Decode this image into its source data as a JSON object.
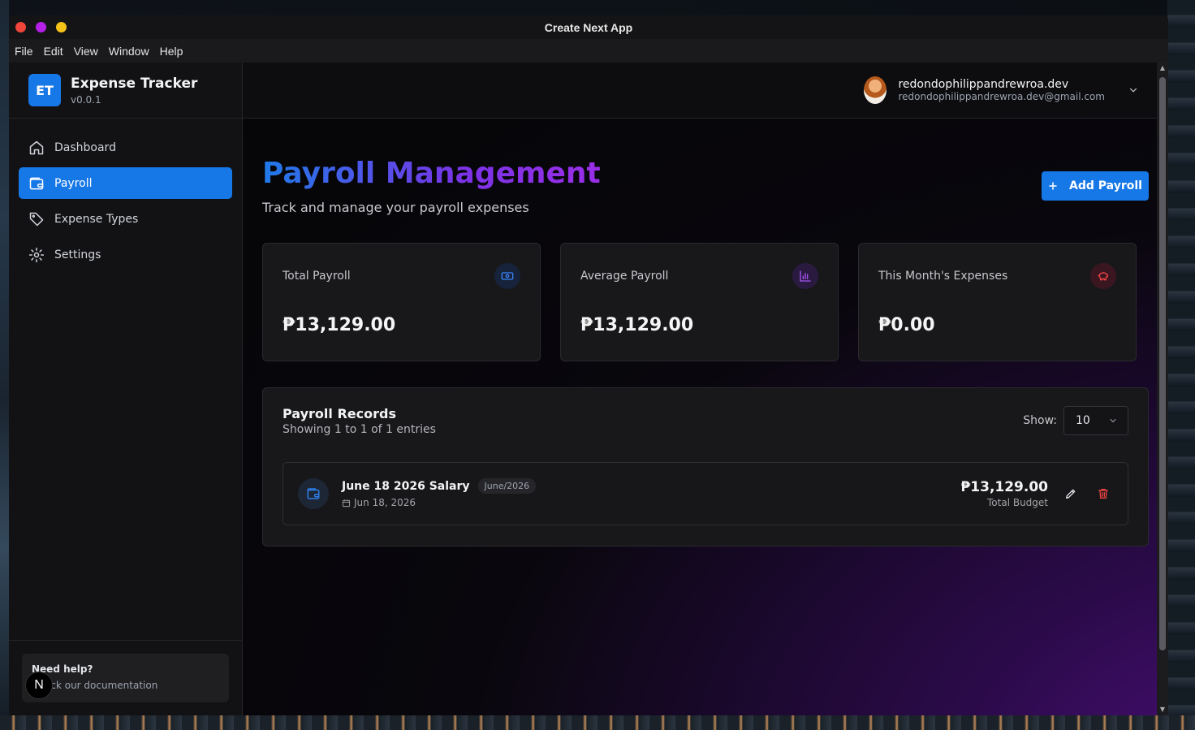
{
  "window": {
    "title": "Create Next App"
  },
  "menu": [
    "File",
    "Edit",
    "View",
    "Window",
    "Help"
  ],
  "sidebar": {
    "logo": "ET",
    "app_name": "Expense Tracker",
    "version": "v0.0.1",
    "items": [
      {
        "label": "Dashboard",
        "icon": "home-icon",
        "active": false
      },
      {
        "label": "Payroll",
        "icon": "wallet-icon",
        "active": true
      },
      {
        "label": "Expense Types",
        "icon": "tag-icon",
        "active": false
      },
      {
        "label": "Settings",
        "icon": "gear-icon",
        "active": false
      }
    ],
    "help": {
      "title": "Need help?",
      "subtitle": "Check our documentation",
      "badge": "N"
    }
  },
  "header": {
    "user_name": "redondophilippandrewroa.dev",
    "user_email": "redondophilippandrewroa.dev@gmail.com"
  },
  "page": {
    "title": "Payroll Management",
    "subtitle": "Track and manage your payroll expenses",
    "add_button": "Add Payroll"
  },
  "stats": [
    {
      "label": "Total Payroll",
      "value": "₱13,129.00",
      "icon": "banknote-icon",
      "color": "#3b82f6"
    },
    {
      "label": "Average Payroll",
      "value": "₱13,129.00",
      "icon": "bar-chart-icon",
      "color": "#a855f7"
    },
    {
      "label": "This Month's Expenses",
      "value": "₱0.00",
      "icon": "piggy-bank-icon",
      "color": "#ef4444"
    }
  ],
  "records": {
    "title": "Payroll Records",
    "subtitle": "Showing 1 to 1 of 1 entries",
    "show_label": "Show:",
    "page_size": "10",
    "rows": [
      {
        "name": "June 18 2026 Salary",
        "tag": "June/2026",
        "date": "Jun 18, 2026",
        "amount": "₱13,129.00",
        "amount_label": "Total Budget"
      }
    ]
  },
  "colors": {
    "accent": "#1677e6",
    "danger": "#ef4444"
  }
}
